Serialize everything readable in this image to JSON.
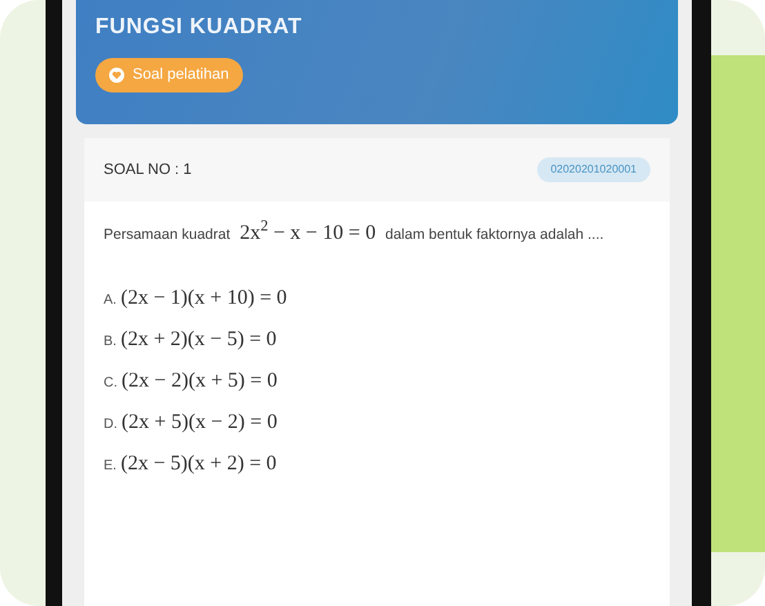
{
  "header": {
    "title": "FUNGSI KUADRAT",
    "badge": "Soal pelatihan"
  },
  "question": {
    "number_label": "SOAL NO : 1",
    "code": "02020201020001",
    "text_before": "Persamaan kuadrat",
    "equation": "2x$^{2}$ − x − 10 = 0",
    "text_after": "dalam bentuk faktornya adalah ....",
    "options": [
      {
        "letter": "A.",
        "math": "(2x − 1)(x + 10) = 0"
      },
      {
        "letter": "B.",
        "math": "(2x + 2)(x − 5) = 0"
      },
      {
        "letter": "C.",
        "math": "(2x − 2)(x + 5) = 0"
      },
      {
        "letter": "D.",
        "math": "(2x + 5)(x − 2) = 0"
      },
      {
        "letter": "E.",
        "math": "(2x − 5)(x + 2) = 0"
      }
    ]
  }
}
